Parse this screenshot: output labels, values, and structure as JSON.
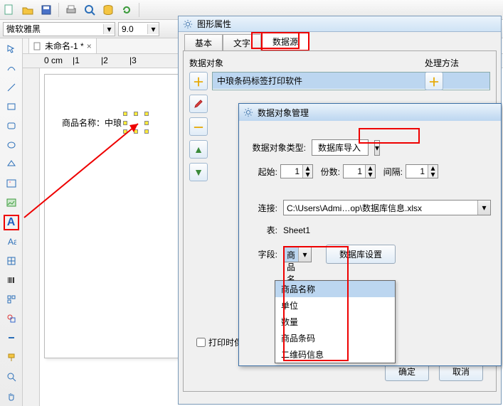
{
  "toolbar": {
    "font_name": "微软雅黑",
    "font_size": "9.0"
  },
  "doc": {
    "tab_title": "未命名-1 *",
    "ruler_zero": "0 cm",
    "ruler_ticks": [
      "|1",
      "|2",
      "|3"
    ],
    "label_prefix": "商品名称：",
    "label_value": "中琅"
  },
  "props": {
    "window_title": "图形属性",
    "tabs": {
      "basic": "基本",
      "text": "文字",
      "datasource": "数据源"
    },
    "section_data_obj": "数据对象",
    "section_method": "处理方法",
    "data_obj_item": "中琅条码标签打印软件",
    "print_checkbox": "打印时保存",
    "ok": "确定",
    "cancel": "取消"
  },
  "dlg": {
    "title": "数据对象管理",
    "type_label": "数据对象类型:",
    "type_value": "数据库导入",
    "start_label": "起始:",
    "start_value": "1",
    "copies_label": "份数:",
    "copies_value": "1",
    "gap_label": "间隔:",
    "gap_value": "1",
    "conn_label": "连接:",
    "conn_value": "C:\\Users\\Admi…op\\数据库信息.xlsx",
    "table_label": "表:",
    "table_value": "Sheet1",
    "field_label": "字段:",
    "field_value": "商品名称",
    "db_settings_btn": "数据库设置",
    "field_options": [
      "商品名称",
      "单位",
      "数量",
      "商品条码",
      "二维码信息"
    ]
  }
}
